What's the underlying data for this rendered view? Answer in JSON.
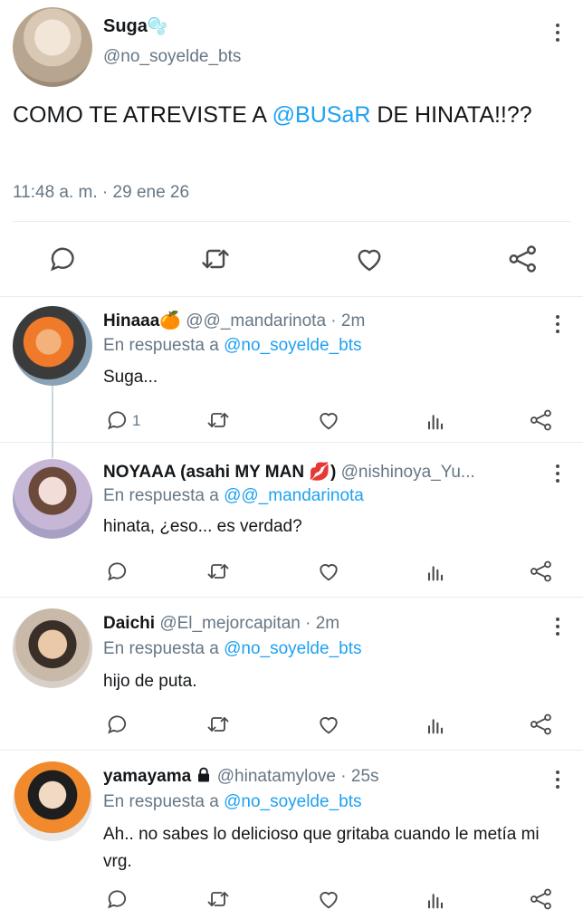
{
  "main_tweet": {
    "author_name": "Suga",
    "name_emoji": "🫧",
    "handle": "@no_soyelde_bts",
    "text_before": "COMO TE ATREVISTE A ",
    "mention": "@BUSaR",
    "text_after": " DE HINATA!!??",
    "timestamp": "11:48 a. m. · 29 ene 26",
    "actions": [
      "reply-icon",
      "retweet-icon",
      "like-icon",
      "share-icon"
    ]
  },
  "replies": [
    {
      "name": "Hinaaa🍊",
      "handle": "@@_mandarinota",
      "time": "· 2m",
      "reply_label": "En respuesta a ",
      "reply_to": "@no_soyelde_bts",
      "text": "Suga...",
      "reply_count": "1"
    },
    {
      "name": "NOYAAA (asahi MY MAN 💋)",
      "handle": "@nishinoya_Yu...",
      "time": "",
      "reply_label": "En respuesta a ",
      "reply_to": "@@_mandarinota",
      "text": "hinata, ¿eso... es verdad?",
      "reply_count": ""
    },
    {
      "name": "Daichi",
      "handle": "@El_mejorcapitan",
      "time": "· 2m",
      "reply_label": "En respuesta a ",
      "reply_to": "@no_soyelde_bts",
      "text": "hijo de puta.",
      "reply_count": ""
    },
    {
      "name": "yamayama",
      "name_icon": "lock-icon",
      "handle": "@hinatamylove",
      "time": "· 25s",
      "reply_label": "En respuesta a ",
      "reply_to": "@no_soyelde_bts",
      "text": "Ah.. no sabes lo delicioso que gritaba cuando le metía mi vrg.",
      "reply_count": ""
    }
  ],
  "colors": {
    "link": "#1da1f2",
    "secondary_text": "#657786",
    "divider": "#e6ecf0"
  }
}
